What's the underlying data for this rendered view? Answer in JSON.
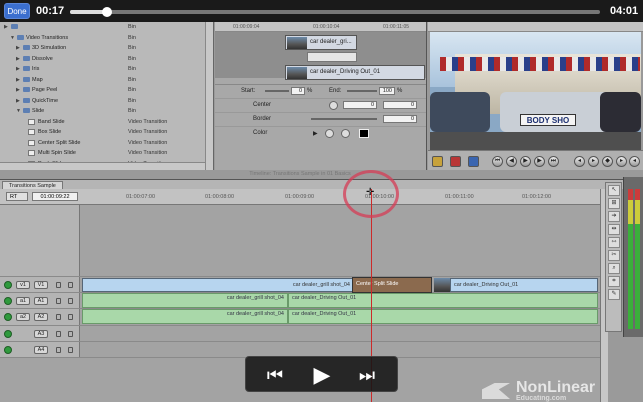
{
  "player": {
    "done_label": "Done",
    "current_time": "00:17",
    "end_time": "04:01",
    "progress": 0.07
  },
  "browser": {
    "items": [
      {
        "name": "",
        "kind": "Bin"
      },
      {
        "name": "Video Transitions",
        "kind": "Bin"
      },
      {
        "name": "3D Simulation",
        "kind": "Bin"
      },
      {
        "name": "Dissolve",
        "kind": "Bin"
      },
      {
        "name": "Iris",
        "kind": "Bin"
      },
      {
        "name": "Map",
        "kind": "Bin"
      },
      {
        "name": "Page Peel",
        "kind": "Bin"
      },
      {
        "name": "QuickTime",
        "kind": "Bin"
      },
      {
        "name": "Slide",
        "kind": "Bin"
      },
      {
        "name": "Band Slide",
        "kind": "Video Transition"
      },
      {
        "name": "Box Slide",
        "kind": "Video Transition"
      },
      {
        "name": "Center Split Slide",
        "kind": "Video Transition"
      },
      {
        "name": "Multi Spin Slide",
        "kind": "Video Transition"
      },
      {
        "name": "Push Slide",
        "kind": "Video Transition"
      }
    ]
  },
  "viewer": {
    "ticks": [
      "01:00:09:04",
      "01:00:10:04",
      "01:00:11:05"
    ],
    "clip_a": "car dealer_gri...",
    "clip_b": "car dealer_Driving Out_01",
    "start_label": "Start:",
    "start_value": "0",
    "end_label": "End:",
    "end_value": "100",
    "pct": "%",
    "params": [
      {
        "label": "Center",
        "value": "0",
        "value2": "0"
      },
      {
        "label": "Border",
        "value": "0"
      },
      {
        "label": "Color"
      }
    ]
  },
  "canvas": {
    "sign_text": "BODY SHO"
  },
  "timeline": {
    "title": "Timeline: Transitions Sample in 01 Basics",
    "tab": "Transitions Sample",
    "rt": "RT",
    "timecode": "01:00:09:22",
    "ticks": [
      "01:00:07:00",
      "01:00:08:00",
      "01:00:09:00",
      "01:00:10:00",
      "01:00:11:00",
      "01:00:12:00"
    ],
    "tracks": [
      {
        "src": "v1",
        "dst": "V1"
      },
      {
        "src": "a1",
        "dst": "A1"
      },
      {
        "src": "a2",
        "dst": "A2"
      },
      {
        "src": "",
        "dst": "A3"
      },
      {
        "src": "",
        "dst": "A4"
      }
    ],
    "v1_clip_a": "car dealer_grill shot_04",
    "v1_transition": "Center Split Slide",
    "v1_clip_b": "car dealer_Driving Out_01",
    "a1_clip_a": "car dealer_grill shot_04",
    "a1_clip_b": "car dealer_Driving Out_01",
    "a2_clip_a": "car dealer_grill shot_04",
    "a2_clip_b": "car dealer_Driving Out_01"
  },
  "overlay": {
    "prev": "⏮",
    "play": "▶",
    "next": "⏭"
  },
  "watermark": {
    "name": "NonLinear",
    "sub": "Educating.com"
  },
  "colors": {
    "accent": "#3b6fcf",
    "annotation": "#d63c56",
    "video_clip": "#b7d5ef",
    "audio_clip": "#a9d8a9"
  }
}
